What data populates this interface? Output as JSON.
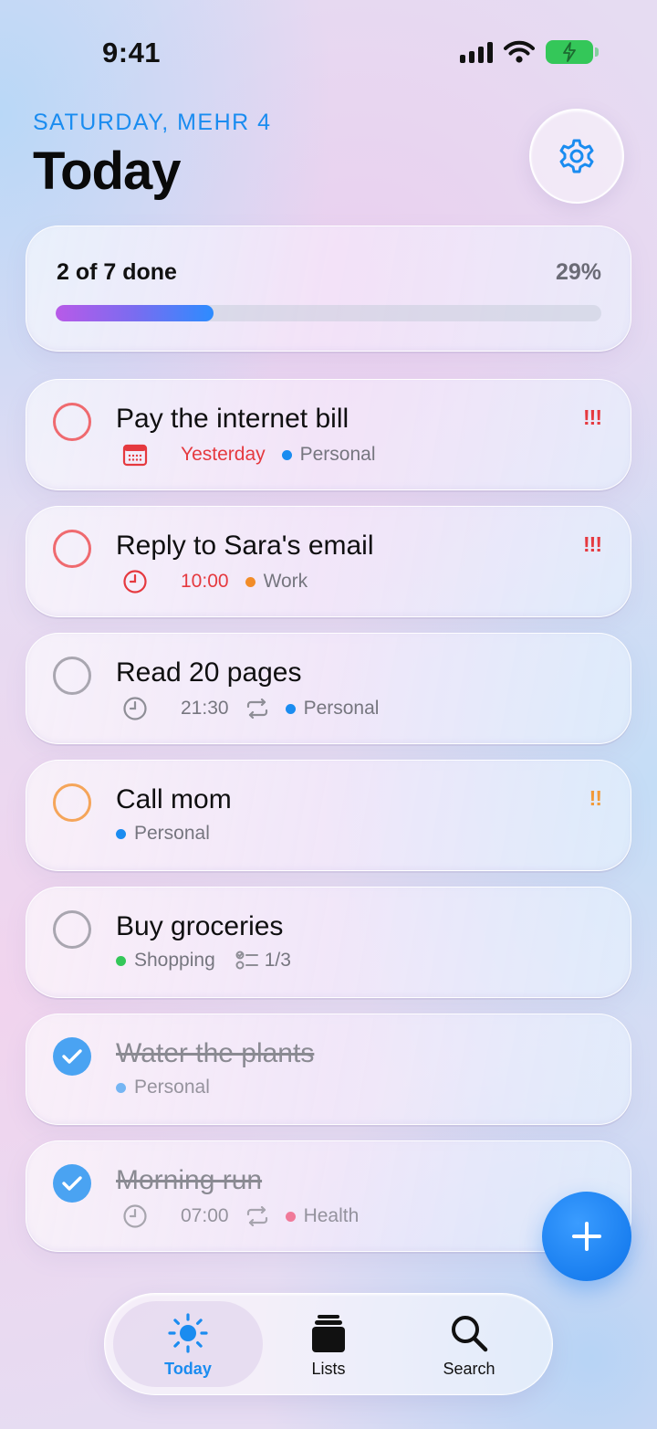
{
  "status": {
    "time": "9:41"
  },
  "header": {
    "date": "SATURDAY, MEHR 4",
    "title": "Today"
  },
  "progress": {
    "text": "2 of 7 done",
    "percent": "29%",
    "fraction": 0.29
  },
  "tasks": [
    {
      "title": "Pay the internet bill",
      "due": "Yesterday",
      "list": "Personal",
      "priority": "!!!"
    },
    {
      "title": "Reply to Sara's email",
      "due": "10:00",
      "list": "Work",
      "priority": "!!!"
    },
    {
      "title": "Read 20 pages",
      "due": "21:30",
      "list": "Personal"
    },
    {
      "title": "Call mom",
      "list": "Personal",
      "priority": "!!"
    },
    {
      "title": "Buy groceries",
      "list": "Shopping",
      "subtasks": "1/3"
    },
    {
      "title": "Water the plants",
      "list": "Personal"
    },
    {
      "title": "Morning run",
      "due": "07:00",
      "list": "Health"
    }
  ],
  "tabs": [
    {
      "label": "Today"
    },
    {
      "label": "Lists"
    },
    {
      "label": "Search"
    }
  ],
  "colors": {
    "accent": "#1a8cf0",
    "overdue": "#e5393f",
    "personal": "#1a8cf0",
    "work": "#f28c28",
    "shopping": "#34c759",
    "health": "#f0557a"
  }
}
